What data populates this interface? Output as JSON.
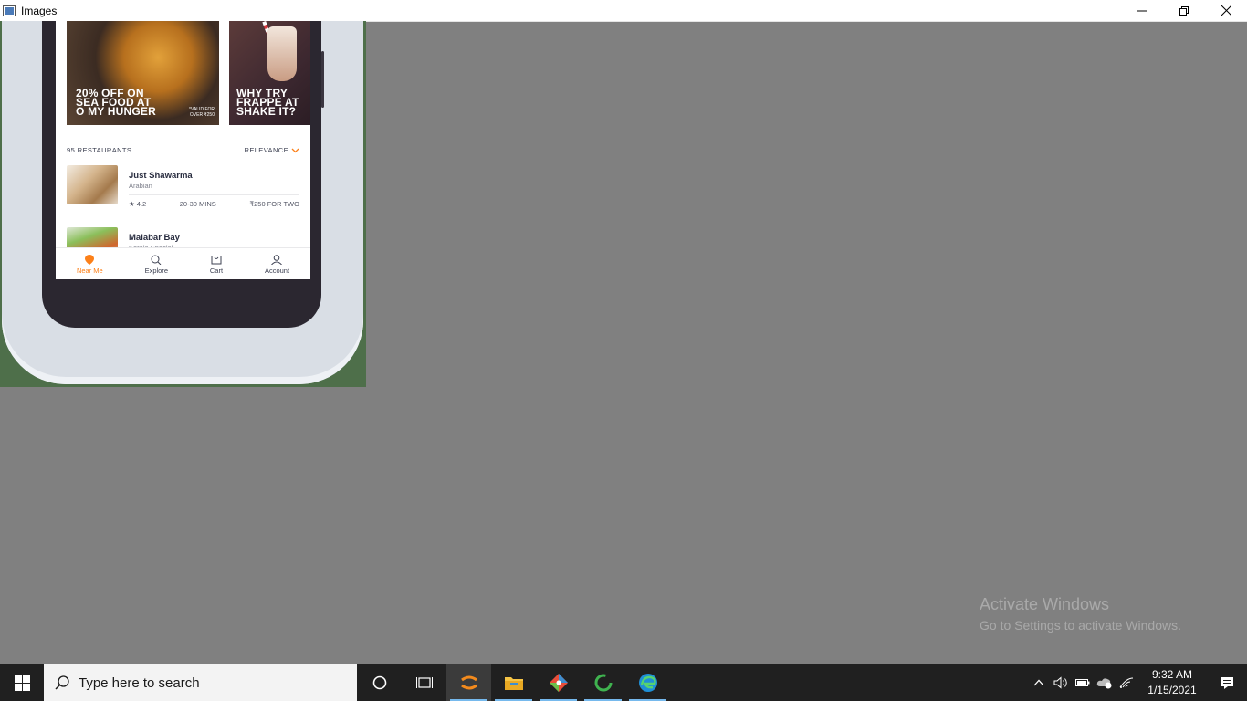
{
  "window": {
    "title": "Images"
  },
  "phone": {
    "banners": [
      {
        "title_lines": [
          "20% OFF ON",
          "SEA FOOD AT",
          "O MY HUNGER"
        ],
        "note_lines": [
          "*VALID FOR",
          "OVER ₹250"
        ]
      },
      {
        "title_lines": [
          "WHY TRY",
          "FRAPPE AT",
          "SHAKE IT?"
        ]
      }
    ],
    "restaurant_count": "95 RESTAURANTS",
    "sort_label": "RELEVANCE",
    "restaurants": [
      {
        "name": "Just Shawarma",
        "cuisine": "Arabian",
        "rating": "★ 4.2",
        "time": "20-30 MINS",
        "price": "₹250 FOR TWO"
      },
      {
        "name": "Malabar Bay",
        "cuisine": "Kerala Special"
      }
    ],
    "nav": [
      {
        "label": "Near Me",
        "icon": "location-pin-icon",
        "active": true
      },
      {
        "label": "Explore",
        "icon": "search-icon"
      },
      {
        "label": "Cart",
        "icon": "cart-icon"
      },
      {
        "label": "Account",
        "icon": "account-icon"
      }
    ],
    "accent": "#fc8019"
  },
  "watermark": {
    "title": "Activate Windows",
    "subtitle": "Go to Settings to activate Windows."
  },
  "taskbar": {
    "search_placeholder": "Type here to search",
    "time": "9:32 AM",
    "date": "1/15/2021"
  }
}
